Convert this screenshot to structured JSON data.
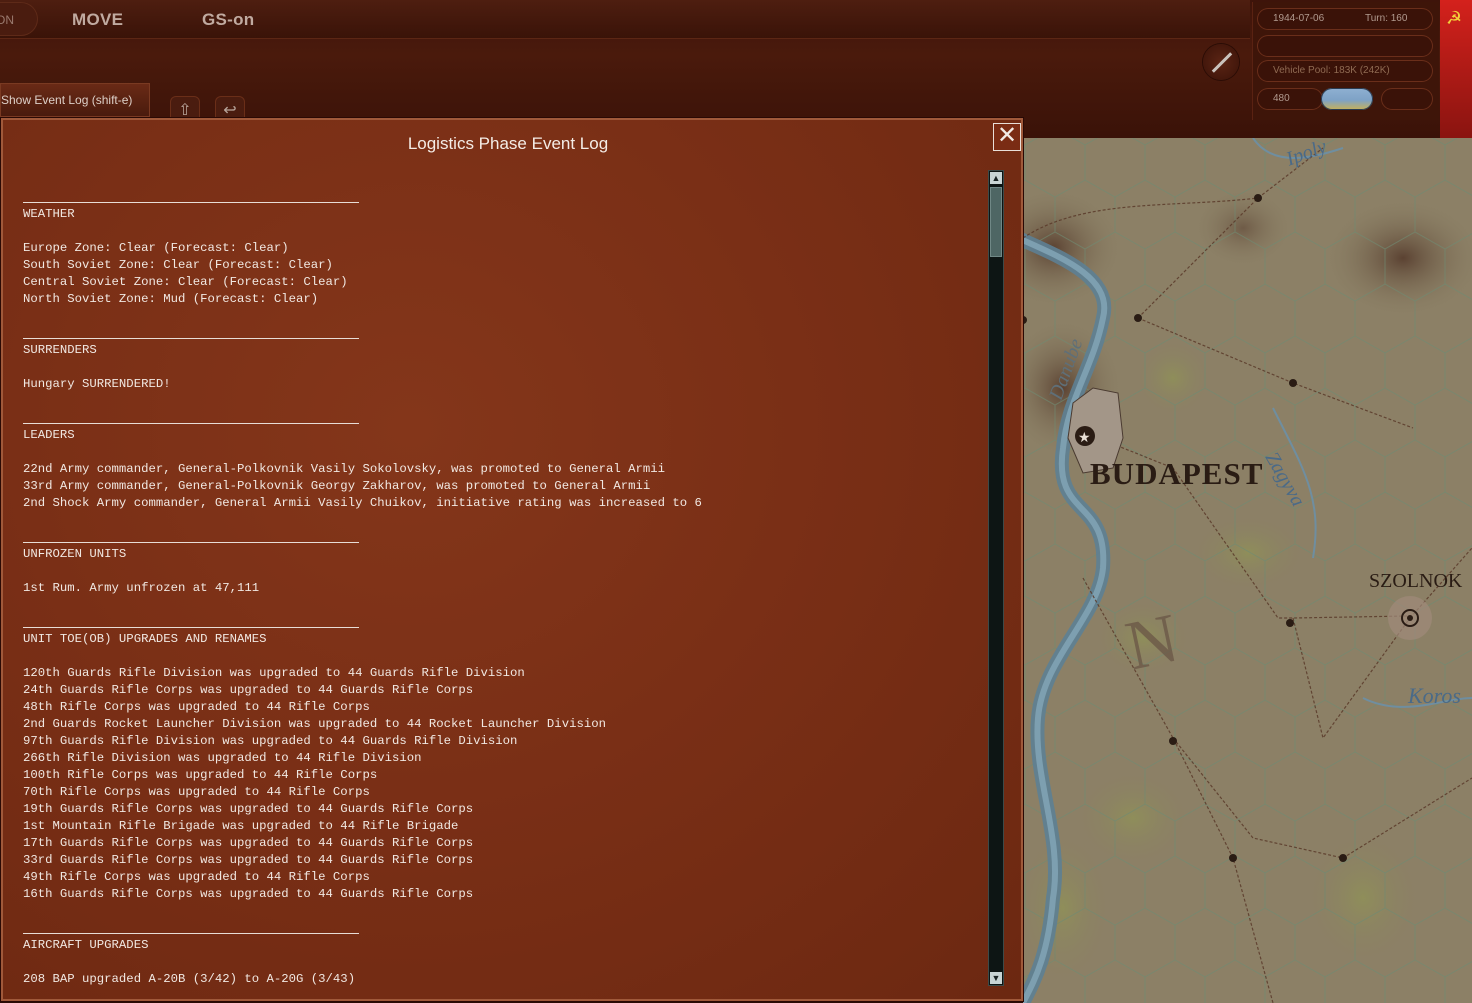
{
  "topbar": {
    "on_tab": "ON",
    "mode_move": "MOVE",
    "mode_gs": "GS-on",
    "event_log_button": "Show Event Log (shift-e)"
  },
  "info_panel": {
    "date": "1944-07-06",
    "turn": "Turn: 160",
    "vehicle_pool": "Vehicle Pool: 183K (242K)",
    "value_480": "480"
  },
  "map": {
    "labels": {
      "budapest": "BUDAPEST",
      "szolnok": "SZOLNOK",
      "ipoly": "Ipoly",
      "danube": "Danube",
      "zagyva": "Zagyva",
      "koros": "Koros",
      "compass": "N"
    }
  },
  "event_log": {
    "title": "Logistics Phase Event Log",
    "close_glyph": "✕",
    "sections": [
      {
        "heading": "WEATHER",
        "lines": [
          "Europe Zone: Clear (Forecast: Clear)",
          "South Soviet Zone: Clear (Forecast: Clear)",
          "Central Soviet Zone: Clear (Forecast: Clear)",
          "North Soviet Zone: Mud (Forecast: Clear)"
        ]
      },
      {
        "heading": "SURRENDERS",
        "lines": [
          "Hungary SURRENDERED!"
        ]
      },
      {
        "heading": "LEADERS",
        "lines": [
          "22nd Army commander, General-Polkovnik Vasily Sokolovsky, was promoted to General Armii",
          "33rd Army commander, General-Polkovnik Georgy Zakharov, was promoted to General Armii",
          "2nd Shock Army commander, General Armii Vasily Chuikov, initiative rating was increased to 6"
        ]
      },
      {
        "heading": "UNFROZEN UNITS",
        "lines": [
          "1st Rum. Army unfrozen at 47,111"
        ]
      },
      {
        "heading": "UNIT TOE(OB) UPGRADES AND RENAMES",
        "lines": [
          "120th Guards Rifle Division was upgraded to 44 Guards Rifle Division",
          "24th Guards Rifle Corps was upgraded to 44 Guards Rifle Corps",
          "48th Rifle Corps was upgraded to 44 Rifle Corps",
          "2nd Guards Rocket Launcher Division was upgraded to 44 Rocket Launcher Division",
          "97th Guards Rifle Division was upgraded to 44 Guards Rifle Division",
          "266th Rifle Division was upgraded to 44 Rifle Division",
          "100th Rifle Corps was upgraded to 44 Rifle Corps",
          "70th Rifle Corps was upgraded to 44 Rifle Corps",
          "19th Guards Rifle Corps was upgraded to 44 Guards Rifle Corps",
          "1st Mountain Rifle Brigade was upgraded to 44 Rifle Brigade",
          "17th Guards Rifle Corps was upgraded to 44 Guards Rifle Corps",
          "33rd Guards Rifle Corps was upgraded to 44 Guards Rifle Corps",
          "49th Rifle Corps was upgraded to 44 Rifle Corps",
          "16th Guards Rifle Corps was upgraded to 44 Guards Rifle Corps"
        ]
      },
      {
        "heading": "AIRCRAFT UPGRADES",
        "lines": [
          "208 BAP upgraded A-20B (3/42) to A-20G (3/43)"
        ]
      }
    ]
  }
}
